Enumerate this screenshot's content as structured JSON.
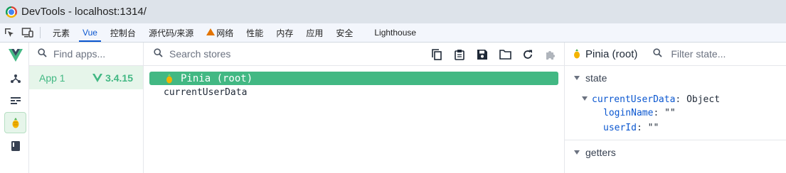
{
  "window": {
    "title": "DevTools - localhost:1314/"
  },
  "devtools_tabs": [
    {
      "label": "元素"
    },
    {
      "label": "Vue"
    },
    {
      "label": "控制台"
    },
    {
      "label": "源代码/来源"
    },
    {
      "label": "网络"
    },
    {
      "label": "性能"
    },
    {
      "label": "内存"
    },
    {
      "label": "应用"
    },
    {
      "label": "安全"
    },
    {
      "label": "Lighthouse"
    }
  ],
  "colors": {
    "vue_green": "#42b883",
    "accent_blue": "#0b57d0",
    "active_bg": "#e6f5ea"
  },
  "apps_panel": {
    "search_placeholder": "Find apps...",
    "app": {
      "name": "App 1",
      "version": "3.4.15"
    }
  },
  "stores_panel": {
    "search_placeholder": "Search stores",
    "selected_store": "Pinia (root)",
    "stores": [
      "currentUserData"
    ]
  },
  "state_panel": {
    "title": "Pinia (root)",
    "filter_placeholder": "Filter state...",
    "state_label": "state",
    "getters_label": "getters",
    "object_key": "currentUserData",
    "object_type": "Object",
    "fields": [
      {
        "key": "loginName",
        "value": "\"\""
      },
      {
        "key": "userId",
        "value": "\"\""
      }
    ]
  }
}
